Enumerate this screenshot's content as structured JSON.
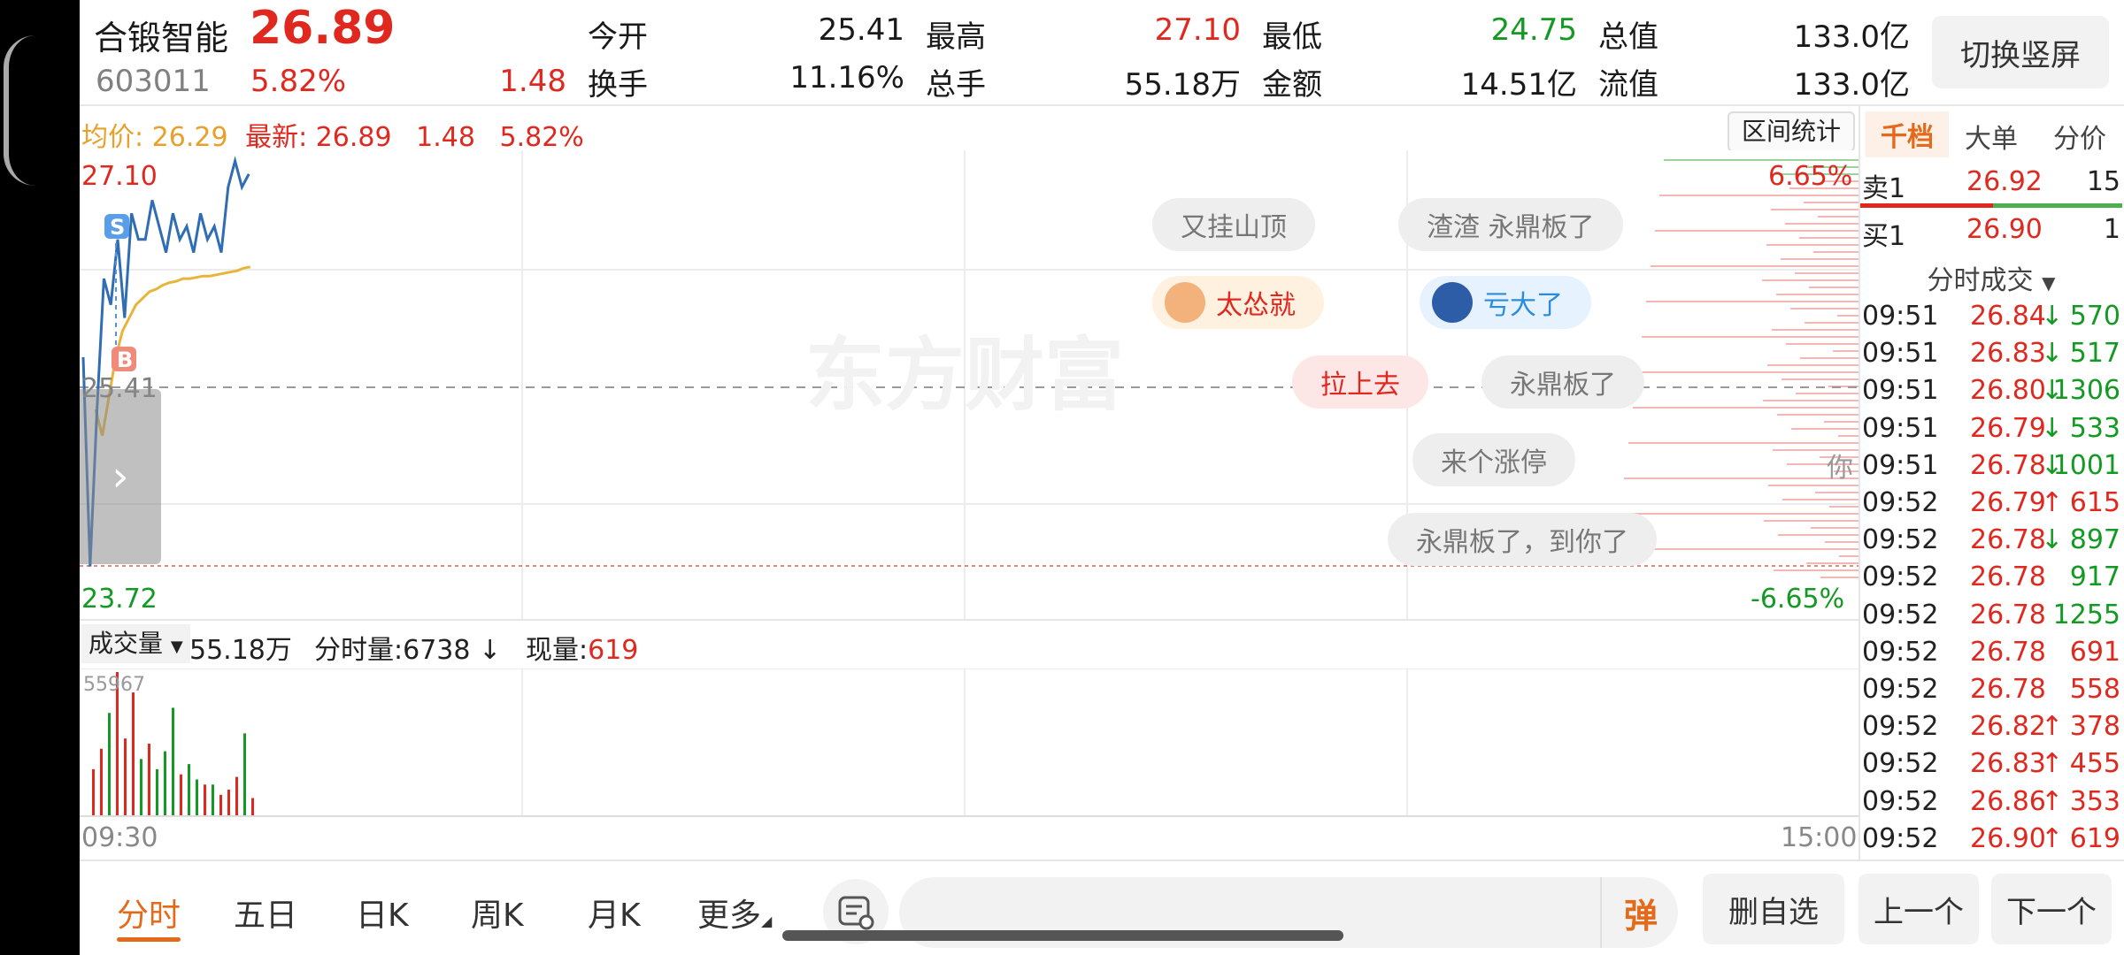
{
  "header": {
    "stock_name": "合锻智能",
    "price": "26.89",
    "code": "603011",
    "change_pct": "5.82%",
    "change_abs": "1.48",
    "stats_row1": [
      {
        "label": "今开",
        "value": "25.41"
      },
      {
        "label": "最高",
        "value": "27.10"
      },
      {
        "label": "最低",
        "value": "24.75"
      },
      {
        "label": "总值",
        "value": "133.0亿"
      }
    ],
    "stats_row2": [
      {
        "label": "换手",
        "value": "11.16%"
      },
      {
        "label": "总手",
        "value": "55.18万"
      },
      {
        "label": "金额",
        "value": "14.51亿"
      },
      {
        "label": "流值",
        "value": "133.0亿"
      }
    ],
    "switch_label": "切换竖屏"
  },
  "chart": {
    "info_avg": "均价: 26.29",
    "info_latest": "最新: 26.89",
    "info_change": "1.48",
    "info_pct": "5.82%",
    "range_stats_label": "区间统计",
    "high_label": "27.10",
    "high_pct": "6.65%",
    "open_label": "25.41",
    "low_label": "23.72",
    "low_pct": "-6.65%",
    "watermark": "东方财富",
    "marker_sell": "S",
    "marker_buy": "B",
    "expand_arrow": "›",
    "comments": [
      {
        "text": "又挂山顶",
        "style": "gray"
      },
      {
        "text": "渣渣 永鼎板了",
        "style": "gray"
      },
      {
        "text": "太怂就",
        "style": "orange"
      },
      {
        "text": "亏大了",
        "style": "blue"
      },
      {
        "text": "拉上去",
        "style": "red"
      },
      {
        "text": "永鼎板了",
        "style": "gray"
      },
      {
        "text": "来个涨停",
        "style": "gray"
      },
      {
        "text": "永鼎板了，到你了",
        "style": "gray"
      },
      {
        "text": "你",
        "style": "gray"
      }
    ],
    "colors": {
      "price_line": "#2f6db5",
      "avg_line": "#e9b43a",
      "up": "#e0281e",
      "down": "#129a23"
    }
  },
  "volume": {
    "selector_label": "成交量",
    "total": "55.18万",
    "period_vol_label": "分时量:",
    "period_vol": "6738",
    "period_arrow": "↓",
    "current_label": "现量:",
    "current": "619",
    "max_label": "55967",
    "time_start": "09:30",
    "time_end": "15:00"
  },
  "chart_data": {
    "type": "line",
    "price_series": [
      25.6,
      24.0,
      25.2,
      26.2,
      26.0,
      26.5,
      25.9,
      26.7,
      26.5,
      26.5,
      26.8,
      26.6,
      26.4,
      26.7,
      26.5,
      26.6,
      26.4,
      26.7,
      26.5,
      26.6,
      26.4,
      26.9,
      27.1,
      26.9,
      27.0
    ],
    "avg_series": [
      25.2,
      25.0,
      25.3,
      25.6,
      25.8,
      25.9,
      26.0,
      26.05,
      26.1,
      26.12,
      26.15,
      26.17,
      26.18,
      26.2,
      26.2,
      26.21,
      26.22,
      26.22,
      26.23,
      26.24,
      26.25,
      26.26,
      26.28,
      26.29
    ],
    "ylim": [
      23.72,
      27.1
    ],
    "volume_series": [
      {
        "v": 18000,
        "dir": "up"
      },
      {
        "v": 26000,
        "dir": "up"
      },
      {
        "v": 40000,
        "dir": "down"
      },
      {
        "v": 55967,
        "dir": "up"
      },
      {
        "v": 30000,
        "dir": "up"
      },
      {
        "v": 48000,
        "dir": "up"
      },
      {
        "v": 22000,
        "dir": "down"
      },
      {
        "v": 28000,
        "dir": "up"
      },
      {
        "v": 18000,
        "dir": "down"
      },
      {
        "v": 25000,
        "dir": "down"
      },
      {
        "v": 42000,
        "dir": "down"
      },
      {
        "v": 16000,
        "dir": "up"
      },
      {
        "v": 20000,
        "dir": "down"
      },
      {
        "v": 14000,
        "dir": "down"
      },
      {
        "v": 12000,
        "dir": "up"
      },
      {
        "v": 12000,
        "dir": "down"
      },
      {
        "v": 8000,
        "dir": "up"
      },
      {
        "v": 10000,
        "dir": "up"
      },
      {
        "v": 15000,
        "dir": "up"
      },
      {
        "v": 32000,
        "dir": "down"
      },
      {
        "v": 6738,
        "dir": "up"
      }
    ]
  },
  "right_panel": {
    "tabs": [
      "千档",
      "大单",
      "分价"
    ],
    "ask": {
      "label": "卖1",
      "price": "26.92",
      "qty": "15"
    },
    "bid": {
      "label": "买1",
      "price": "26.90",
      "qty": "1"
    },
    "ticks_title": "分时成交",
    "ticks": [
      {
        "time": "09:51",
        "price": "26.84",
        "arrow": "↓",
        "qty": "570",
        "dir": "down"
      },
      {
        "time": "09:51",
        "price": "26.83",
        "arrow": "↓",
        "qty": "517",
        "dir": "down"
      },
      {
        "time": "09:51",
        "price": "26.80",
        "arrow": "↓",
        "qty": "1306",
        "dir": "down"
      },
      {
        "time": "09:51",
        "price": "26.79",
        "arrow": "↓",
        "qty": "533",
        "dir": "down"
      },
      {
        "time": "09:51",
        "price": "26.78",
        "arrow": "↓",
        "qty": "1001",
        "dir": "down"
      },
      {
        "time": "09:52",
        "price": "26.79",
        "arrow": "↑",
        "qty": "615",
        "dir": "up"
      },
      {
        "time": "09:52",
        "price": "26.78",
        "arrow": "↓",
        "qty": "897",
        "dir": "down"
      },
      {
        "time": "09:52",
        "price": "26.78",
        "arrow": "",
        "qty": "917",
        "dir": "down"
      },
      {
        "time": "09:52",
        "price": "26.78",
        "arrow": "",
        "qty": "1255",
        "dir": "down"
      },
      {
        "time": "09:52",
        "price": "26.78",
        "arrow": "",
        "qty": "691",
        "dir": "up"
      },
      {
        "time": "09:52",
        "price": "26.78",
        "arrow": "",
        "qty": "558",
        "dir": "up"
      },
      {
        "time": "09:52",
        "price": "26.82",
        "arrow": "↑",
        "qty": "378",
        "dir": "up"
      },
      {
        "time": "09:52",
        "price": "26.83",
        "arrow": "↑",
        "qty": "455",
        "dir": "up"
      },
      {
        "time": "09:52",
        "price": "26.86",
        "arrow": "↑",
        "qty": "353",
        "dir": "up"
      },
      {
        "time": "09:52",
        "price": "26.90",
        "arrow": "↑",
        "qty": "619",
        "dir": "up"
      }
    ]
  },
  "bottom": {
    "tabs": [
      "分时",
      "五日",
      "日K",
      "周K",
      "月K",
      "更多"
    ],
    "danmu_label": "弹",
    "buttons": [
      "删自选",
      "上一个",
      "下一个"
    ]
  }
}
